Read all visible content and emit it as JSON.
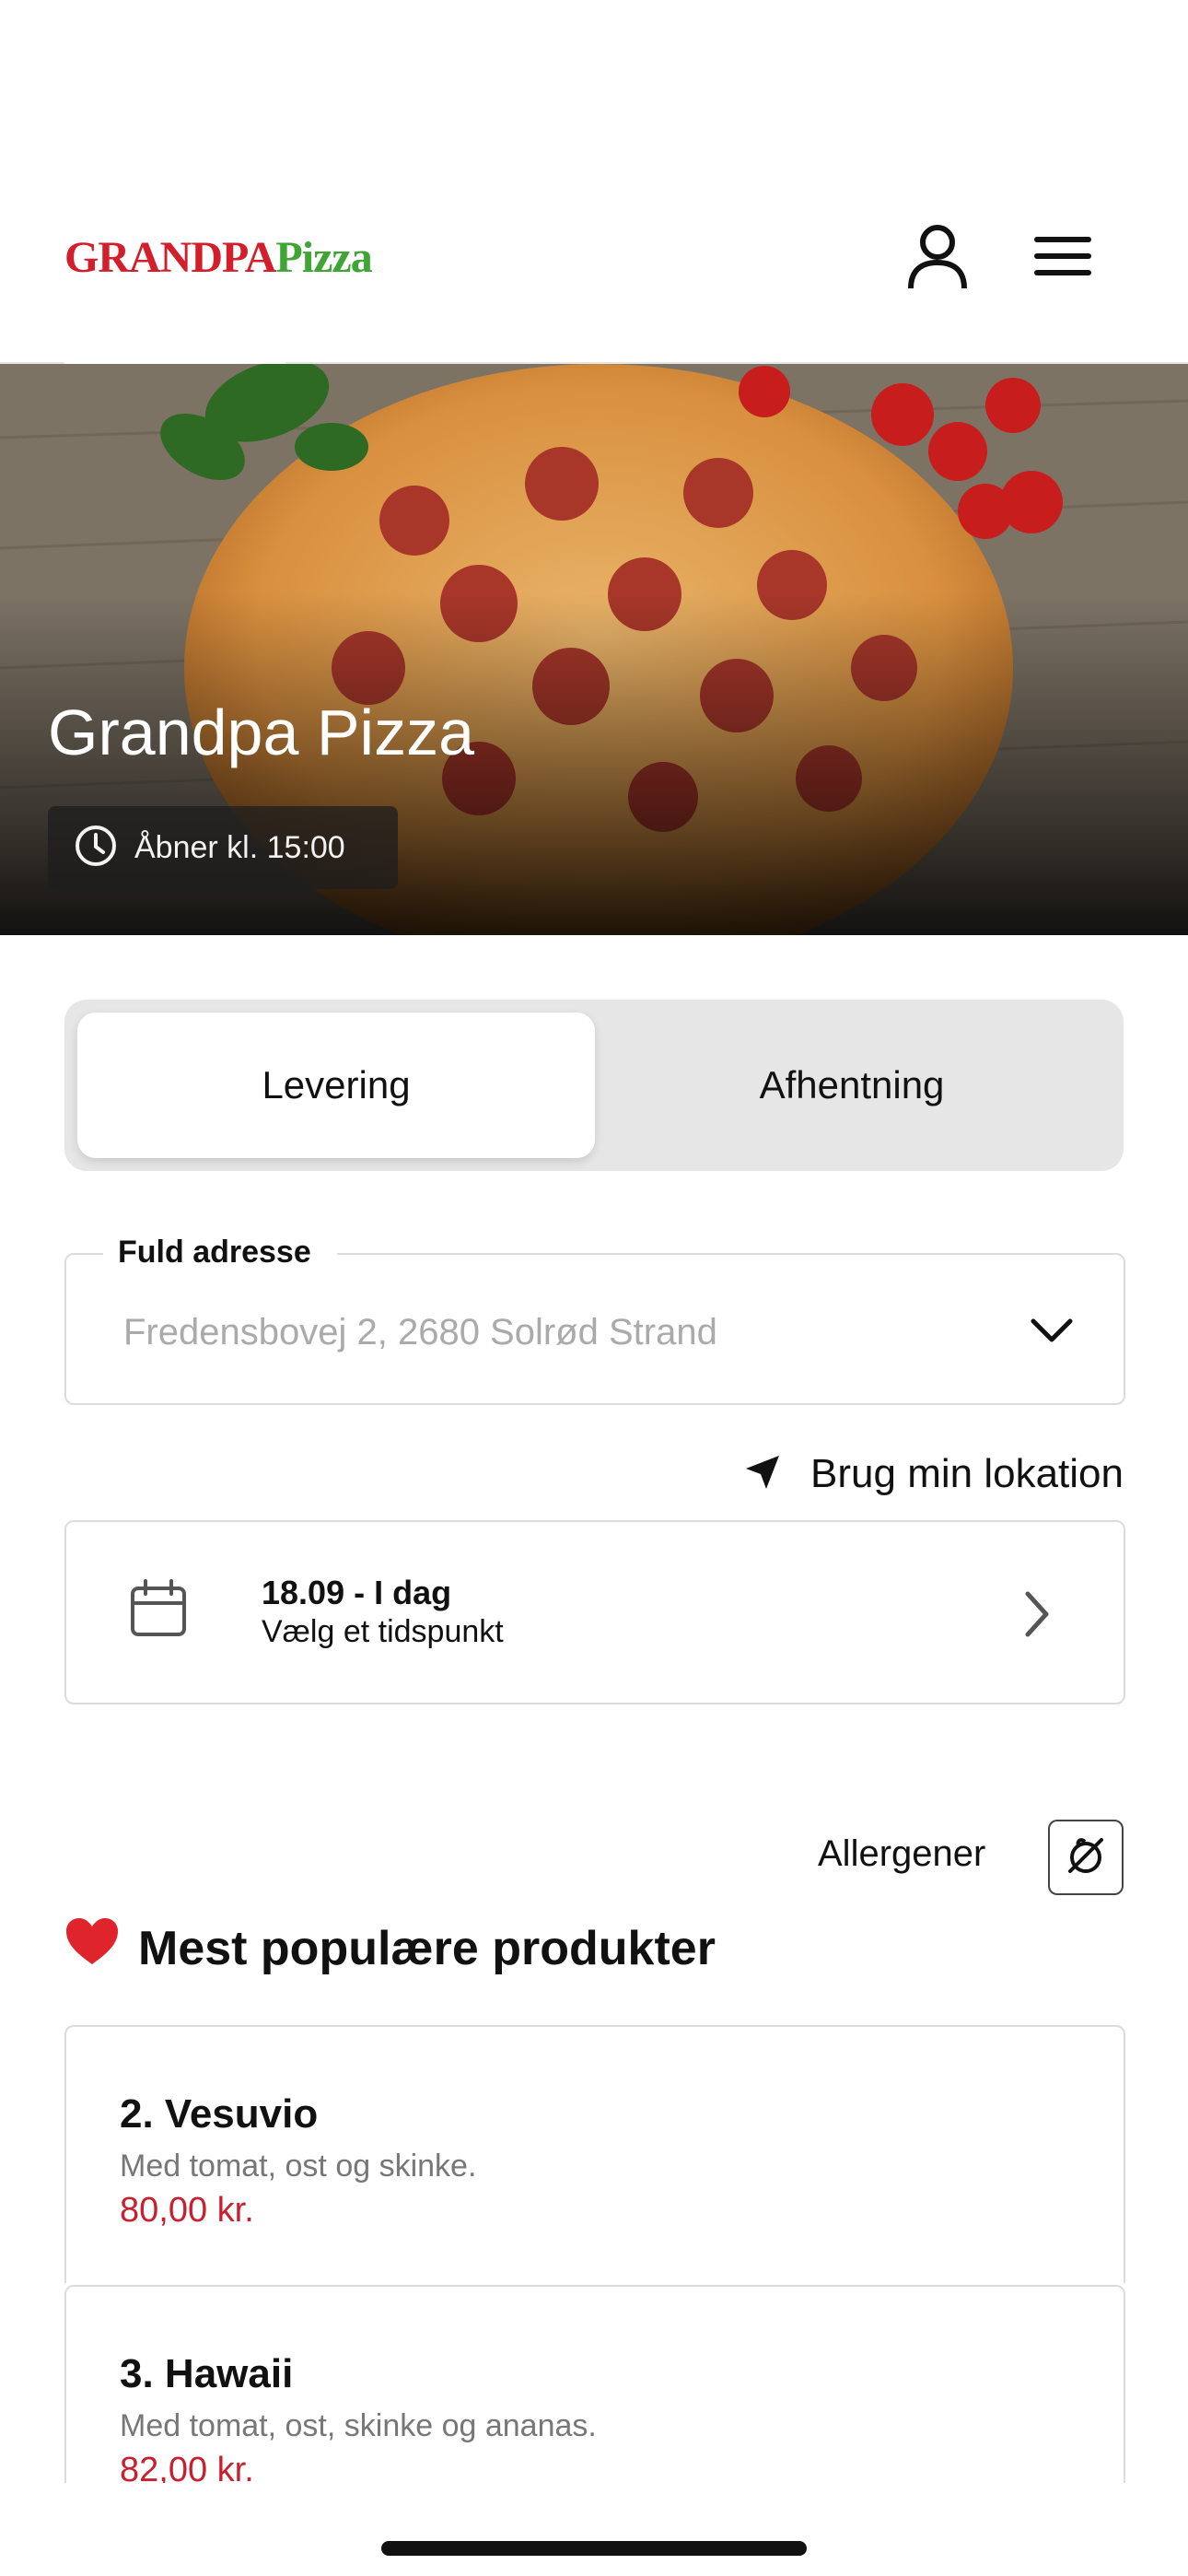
{
  "header": {
    "logo_part1": "GRANDPA",
    "logo_part2": "Pizza",
    "profile_icon": "user-icon",
    "menu_icon": "hamburger-menu-icon"
  },
  "hero": {
    "title": "Grandpa Pizza",
    "opening_text": "Åbner kl. 15:00",
    "clock_icon": "clock-icon"
  },
  "order_mode": {
    "delivery_label": "Levering",
    "pickup_label": "Afhentning",
    "selected": "Levering"
  },
  "address": {
    "label": "Fuld adresse",
    "placeholder": "Fredensbovej 2, 2680 Solrød Strand"
  },
  "location": {
    "label": "Brug min lokation",
    "icon": "location-arrow-icon"
  },
  "time_select": {
    "date_line": "18.09 - I dag",
    "subtitle": "Vælg et tidspunkt"
  },
  "allergens": {
    "label": "Allergener"
  },
  "popular": {
    "title": "Mest populære produkter",
    "products": [
      {
        "name": "2. Vesuvio",
        "description": "Med tomat, ost og skinke.",
        "price": "80,00 kr."
      },
      {
        "name": "3. Hawaii",
        "description": "Med tomat, ost, skinke og ananas.",
        "price": "82,00 kr."
      }
    ]
  },
  "colors": {
    "logo_red": "#d21f2b",
    "logo_green": "#3fa535",
    "price_red": "#c8202e",
    "segment_bg": "#e6e6e6"
  }
}
